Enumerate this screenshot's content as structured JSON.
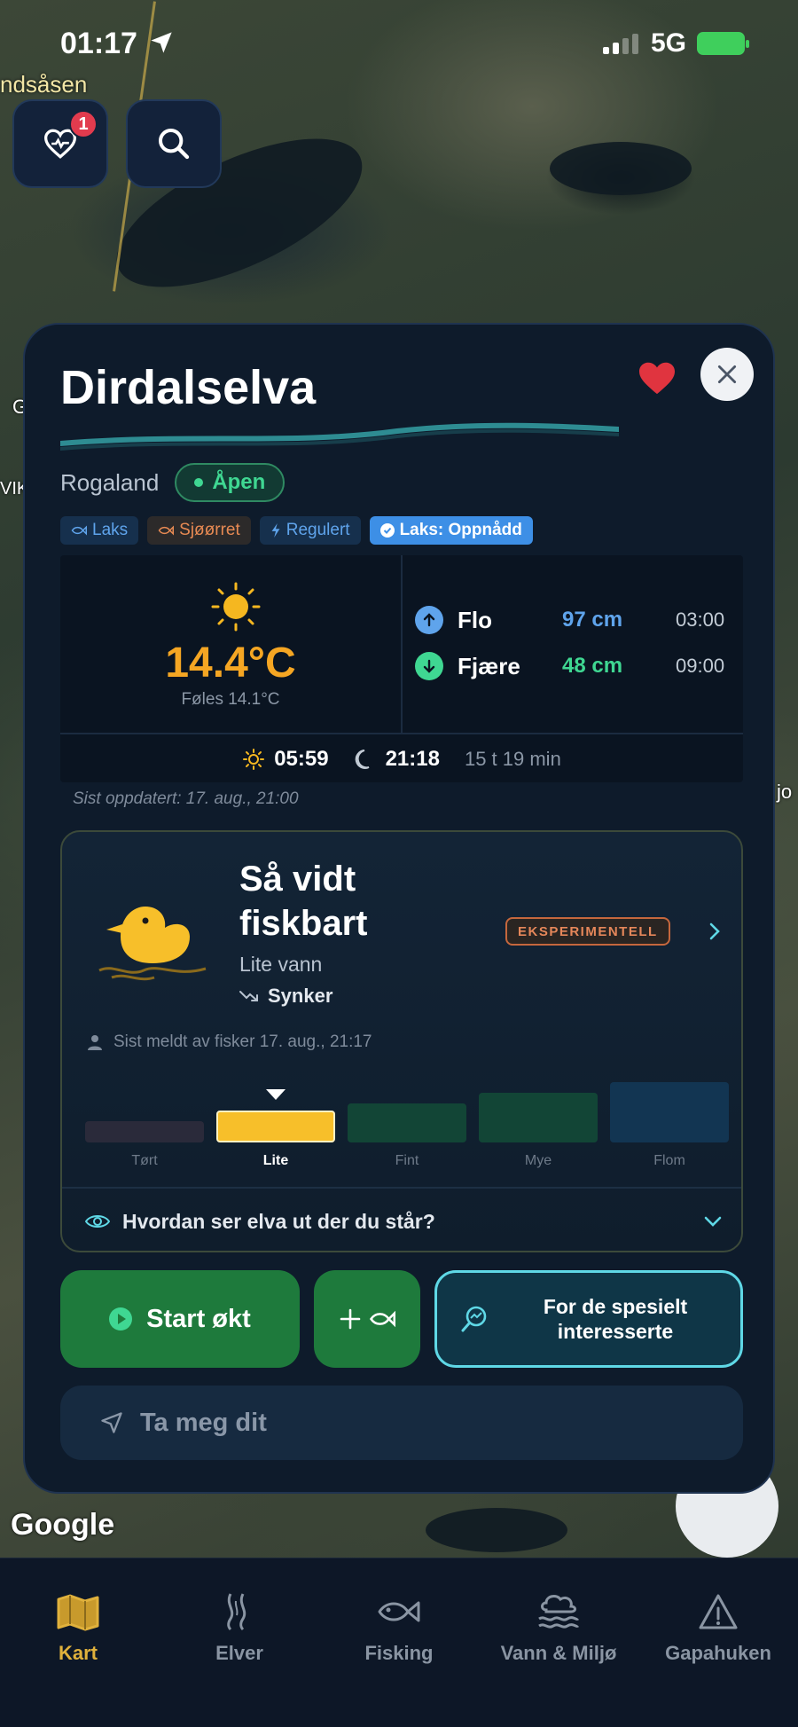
{
  "status_bar": {
    "time": "01:17",
    "network": "5G"
  },
  "map": {
    "place_label_left": "ndsåsen",
    "place_label_side_left": "VIK",
    "place_label_side_left2": "G",
    "place_label_right": "jo",
    "attribution": "Google"
  },
  "top_buttons": {
    "favorites_badge": "1"
  },
  "card": {
    "river_name": "Dirdalselva",
    "region": "Rogaland",
    "status": "Åpen",
    "tags": [
      {
        "label": "Laks",
        "kind": "species"
      },
      {
        "label": "Sjøørret",
        "kind": "species"
      },
      {
        "label": "Regulert",
        "kind": "regulated"
      },
      {
        "label": "Laks: Oppnådd",
        "kind": "quota"
      }
    ],
    "weather": {
      "temperature": "14.4°C",
      "feels_like": "Føles 14.1°C"
    },
    "tides": [
      {
        "name": "Flo",
        "height": "97 cm",
        "time": "03:00",
        "direction": "up",
        "color": "#5fa4ec"
      },
      {
        "name": "Fjære",
        "height": "48 cm",
        "time": "09:00",
        "direction": "down",
        "color": "#3fd792"
      }
    ],
    "sun": {
      "sunrise": "05:59",
      "sunset": "21:18",
      "day_length": "15 t 19 min"
    },
    "last_updated": "Sist oppdatert: 17. aug., 21:00"
  },
  "condition": {
    "title": "Så vidt fiskbart",
    "water": "Lite vann",
    "trend": "Synker",
    "badge": "EKSPERIMENTELL",
    "reported": "Sist meldt av fisker 17. aug., 21:17",
    "current_level": "Lite",
    "level_value": 2,
    "level_count": 5,
    "levels": [
      {
        "label": "Tørt",
        "color": "#2a2a3a"
      },
      {
        "label": "Lite",
        "color": "#f7bf2a"
      },
      {
        "label": "Fint",
        "color": "#124536"
      },
      {
        "label": "Mye",
        "color": "#124536"
      },
      {
        "label": "Flom",
        "color": "#123552"
      }
    ],
    "question": "Hvordan ser elva ut der du står?"
  },
  "actions": {
    "start_session": "Start økt",
    "nerd_button": "For de spesielt interesserte",
    "navigate": "Ta meg dit"
  },
  "tabs": [
    {
      "label": "Kart",
      "active": true
    },
    {
      "label": "Elver",
      "active": false
    },
    {
      "label": "Fisking",
      "active": false
    },
    {
      "label": "Vann & Miljø",
      "active": false
    },
    {
      "label": "Gapahuken",
      "active": false
    }
  ],
  "colors": {
    "accent": "#e0b13c",
    "open_green": "#3fd792",
    "warning": "#e5875a",
    "start_green": "#1e7a3c"
  }
}
